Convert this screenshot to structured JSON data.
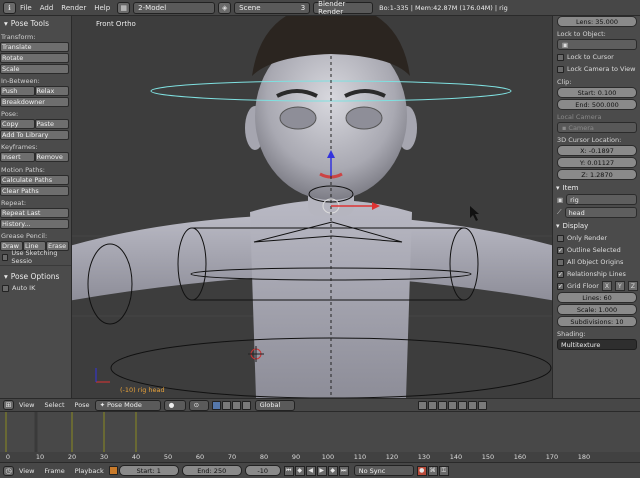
{
  "topbar": {
    "menus": [
      "File",
      "Add",
      "Render",
      "Help"
    ],
    "screen_layout": "2-Model",
    "scene": "Scene",
    "scene_users": "3",
    "render_engine": "Blender Render",
    "info": "Bo:1-335 | Mem:42.87M (176.04M) | rig"
  },
  "shelf": {
    "title": "Pose Tools",
    "transform_label": "Transform:",
    "translate": "Translate",
    "rotate": "Rotate",
    "scale": "Scale",
    "inbetween_label": "In-Between:",
    "push": "Push",
    "relax": "Relax",
    "breakdowner": "Breakdowner",
    "pose_label": "Pose:",
    "copy": "Copy",
    "paste": "Paste",
    "add_to_library": "Add To Library",
    "keyframes_label": "Keyframes:",
    "insert": "Insert",
    "remove": "Remove",
    "motion_paths_label": "Motion Paths:",
    "calculate_paths": "Calculate Paths",
    "clear_paths": "Clear Paths",
    "repeat_label": "Repeat:",
    "repeat_last": "Repeat Last",
    "history": "History...",
    "grease_pencil_label": "Grease Pencil:",
    "draw": "Draw",
    "line": "Line",
    "erase": "Erase",
    "use_sketching": "Use Sketching Sessio",
    "pose_options": "Pose Options",
    "auto_ik": "Auto IK"
  },
  "viewport": {
    "view_label": "Front Ortho",
    "object_label": "(-10) rig head"
  },
  "props": {
    "lens": "Lens: 35.000",
    "lock_to_object_label": "Lock to Object:",
    "lock_to_cursor": "Lock to Cursor",
    "lock_camera_to_view": "Lock Camera to View",
    "clip_label": "Clip:",
    "clip_start": "Start: 0.100",
    "clip_end": "End: 500.000",
    "local_camera_label": "Local Camera",
    "camera_field": "Camera",
    "cursor_label": "3D Cursor Location:",
    "cursor_x": "X: -0.1897",
    "cursor_y": "Y: 0.01127",
    "cursor_z": "Z: 1.2870",
    "item_header": "Item",
    "item_object": "rig",
    "item_bone": "head",
    "display_header": "Display",
    "only_render": "Only Render",
    "outline_selected": "Outline Selected",
    "all_object_origins": "All Object Origins",
    "relationship_lines": "Relationship Lines",
    "grid_floor": "Grid Floor",
    "axis_x": "X",
    "axis_y": "Y",
    "axis_z": "Z",
    "lines": "Lines: 60",
    "grid_scale": "Scale: 1.000",
    "subdivisions": "Subdivisions: 10",
    "shading_label": "Shading:",
    "shading_mode": "Multitexture"
  },
  "vheader": {
    "view": "View",
    "select": "Select",
    "pose": "Pose",
    "mode": "Pose Mode",
    "orientation": "Global"
  },
  "timeline": {
    "ticks": [
      "0",
      "10",
      "20",
      "30",
      "40",
      "50",
      "60",
      "70",
      "80",
      "90",
      "100",
      "110",
      "120",
      "130",
      "140",
      "150",
      "160",
      "170",
      "180"
    ],
    "current_frame_value": -10
  },
  "theader": {
    "view": "View",
    "frame": "Frame",
    "playback": "Playback",
    "start": "Start: 1",
    "end": "End: 250",
    "current": "-10",
    "sync": "No Sync"
  },
  "colors": {
    "accent_orange": "#e8a23a",
    "selection_cyan": "#7fe0e0",
    "keyframe_yellow": "#c8c800"
  }
}
